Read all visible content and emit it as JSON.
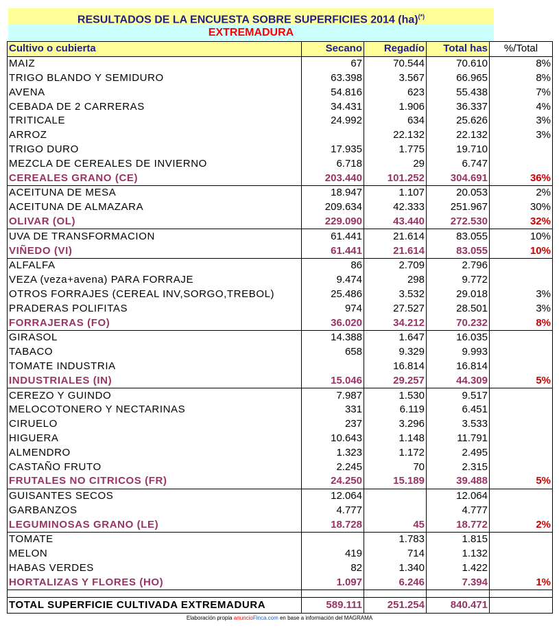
{
  "title": "RESULTADOS DE LA ENCUESTA SOBRE SUPERFICIES 2014 (ha)",
  "title_note": "(*)",
  "region": "EXTREMADURA",
  "headers": {
    "crop": "Cultivo o cubierta",
    "secano": "Secano",
    "regadio": "Regadío",
    "total": "Total has",
    "pct": "%/Total"
  },
  "rows": [
    {
      "type": "item",
      "name": "MAIZ",
      "secano": "67",
      "regadio": "70.544",
      "total": "70.610",
      "pct": "8%"
    },
    {
      "type": "item",
      "name": "TRIGO BLANDO Y SEMIDURO",
      "secano": "63.398",
      "regadio": "3.567",
      "total": "66.965",
      "pct": "8%"
    },
    {
      "type": "item",
      "name": "AVENA",
      "secano": "54.816",
      "regadio": "623",
      "total": "55.438",
      "pct": "7%"
    },
    {
      "type": "item",
      "name": "CEBADA DE 2 CARRERAS",
      "secano": "34.431",
      "regadio": "1.906",
      "total": "36.337",
      "pct": "4%"
    },
    {
      "type": "item",
      "name": "TRITICALE",
      "secano": "24.992",
      "regadio": "634",
      "total": "25.626",
      "pct": "3%"
    },
    {
      "type": "item",
      "name": "ARROZ",
      "secano": "",
      "regadio": "22.132",
      "total": "22.132",
      "pct": "3%"
    },
    {
      "type": "item",
      "name": "TRIGO DURO",
      "secano": "17.935",
      "regadio": "1.775",
      "total": "19.710",
      "pct": ""
    },
    {
      "type": "item",
      "name": "MEZCLA DE CEREALES DE INVIERNO",
      "secano": "6.718",
      "regadio": "29",
      "total": "6.747",
      "pct": ""
    },
    {
      "type": "sub",
      "name": "CEREALES GRANO (CE)",
      "secano": "203.440",
      "regadio": "101.252",
      "total": "304.691",
      "pct": "36%"
    },
    {
      "type": "item",
      "name": "ACEITUNA DE MESA",
      "secano": "18.947",
      "regadio": "1.107",
      "total": "20.053",
      "pct": "2%"
    },
    {
      "type": "item",
      "name": "ACEITUNA DE ALMAZARA",
      "secano": "209.634",
      "regadio": "42.333",
      "total": "251.967",
      "pct": "30%"
    },
    {
      "type": "sub",
      "name": "OLIVAR (OL)",
      "secano": "229.090",
      "regadio": "43.440",
      "total": "272.530",
      "pct": "32%"
    },
    {
      "type": "item",
      "name": "UVA DE TRANSFORMACION",
      "secano": "61.441",
      "regadio": "21.614",
      "total": "83.055",
      "pct": "10%"
    },
    {
      "type": "sub",
      "name": "VIÑEDO (VI)",
      "secano": "61.441",
      "regadio": "21.614",
      "total": "83.055",
      "pct": "10%"
    },
    {
      "type": "item",
      "name": "ALFALFA",
      "secano": "86",
      "regadio": "2.709",
      "total": "2.796",
      "pct": ""
    },
    {
      "type": "item",
      "name": "VEZA (veza+avena) PARA FORRAJE",
      "secano": "9.474",
      "regadio": "298",
      "total": "9.772",
      "pct": ""
    },
    {
      "type": "item",
      "name": "OTROS FORRAJES (CEREAL INV,SORGO,TREBOL)",
      "secano": "25.486",
      "regadio": "3.532",
      "total": "29.018",
      "pct": "3%"
    },
    {
      "type": "item",
      "name": "PRADERAS POLIFITAS",
      "secano": "974",
      "regadio": "27.527",
      "total": "28.501",
      "pct": "3%"
    },
    {
      "type": "sub",
      "name": "FORRAJERAS (FO)",
      "secano": "36.020",
      "regadio": "34.212",
      "total": "70.232",
      "pct": "8%"
    },
    {
      "type": "item",
      "name": "GIRASOL",
      "secano": "14.388",
      "regadio": "1.647",
      "total": "16.035",
      "pct": ""
    },
    {
      "type": "item",
      "name": "TABACO",
      "secano": "658",
      "regadio": "9.329",
      "total": "9.993",
      "pct": ""
    },
    {
      "type": "item",
      "name": "TOMATE INDUSTRIA",
      "secano": "",
      "regadio": "16.814",
      "total": "16.814",
      "pct": ""
    },
    {
      "type": "sub",
      "name": "INDUSTRIALES (IN)",
      "secano": "15.046",
      "regadio": "29.257",
      "total": "44.309",
      "pct": "5%"
    },
    {
      "type": "item",
      "name": "CEREZO Y GUINDO",
      "secano": "7.987",
      "regadio": "1.530",
      "total": "9.517",
      "pct": ""
    },
    {
      "type": "item",
      "name": "MELOCOTONERO Y NECTARINAS",
      "secano": "331",
      "regadio": "6.119",
      "total": "6.451",
      "pct": ""
    },
    {
      "type": "item",
      "name": "CIRUELO",
      "secano": "237",
      "regadio": "3.296",
      "total": "3.533",
      "pct": ""
    },
    {
      "type": "item",
      "name": "HIGUERA",
      "secano": "10.643",
      "regadio": "1.148",
      "total": "11.791",
      "pct": ""
    },
    {
      "type": "item",
      "name": "ALMENDRO",
      "secano": "1.323",
      "regadio": "1.172",
      "total": "2.495",
      "pct": ""
    },
    {
      "type": "item",
      "name": "CASTAÑO FRUTO",
      "secano": "2.245",
      "regadio": "70",
      "total": "2.315",
      "pct": ""
    },
    {
      "type": "sub",
      "name": "FRUTALES NO CITRICOS (FR)",
      "secano": "24.250",
      "regadio": "15.189",
      "total": "39.488",
      "pct": "5%"
    },
    {
      "type": "item",
      "name": "GUISANTES SECOS",
      "secano": "12.064",
      "regadio": "",
      "total": "12.064",
      "pct": ""
    },
    {
      "type": "item",
      "name": "GARBANZOS",
      "secano": "4.777",
      "regadio": "",
      "total": "4.777",
      "pct": ""
    },
    {
      "type": "sub",
      "name": "LEGUMINOSAS GRANO (LE)",
      "secano": "18.728",
      "regadio": "45",
      "total": "18.772",
      "pct": "2%"
    },
    {
      "type": "item",
      "name": "TOMATE",
      "secano": "",
      "regadio": "1.783",
      "total": "1.815",
      "pct": ""
    },
    {
      "type": "item",
      "name": "MELON",
      "secano": "419",
      "regadio": "714",
      "total": "1.132",
      "pct": ""
    },
    {
      "type": "item",
      "name": "HABAS VERDES",
      "secano": "82",
      "regadio": "1.340",
      "total": "1.422",
      "pct": ""
    },
    {
      "type": "sub",
      "name": "HORTALIZAS Y FLORES (HO)",
      "secano": "1.097",
      "regadio": "6.246",
      "total": "7.394",
      "pct": "1%"
    }
  ],
  "total": {
    "name": "TOTAL SUPERFICIE CULTIVADA EXTREMADURA",
    "secano": "589.111",
    "regadio": "251.254",
    "total": "840.471",
    "pct": ""
  },
  "footer": {
    "prefix": "Elaboración propia ",
    "brand_a": "anuncio",
    "brand_b": "Finca.com",
    "suffix": " en base a información del MAGRAMA"
  },
  "colors": {
    "title_bg": "#ffff99",
    "region_bg": "#ccffff",
    "title_text": "#1f1f8c",
    "region_text": "#ff0000",
    "subtotal_text": "#993366",
    "pct_subtotal": "#cc0000"
  }
}
